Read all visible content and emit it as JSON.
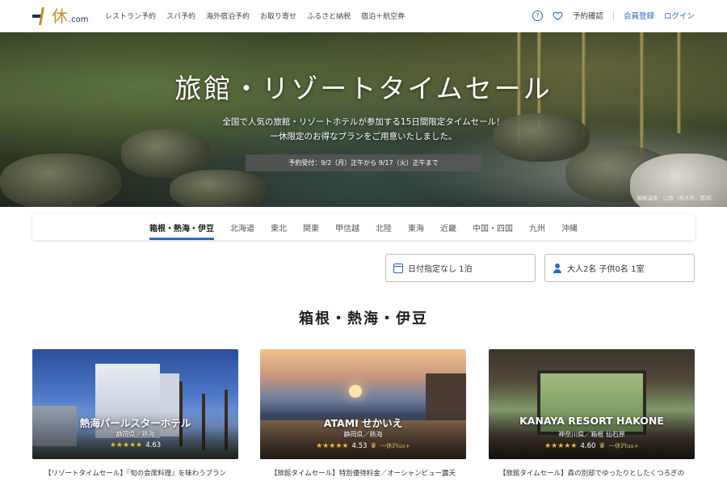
{
  "header": {
    "logo_kanji": "休",
    "logo_com": ".com",
    "nav": [
      "レストラン予約",
      "スパ予約",
      "海外宿泊予約",
      "お取り寄せ",
      "ふるさと納税",
      "宿泊＋航空券"
    ],
    "help_icon": "?",
    "confirm_label": "予約確認",
    "register_label": "会員登録",
    "login_label": "ログイン",
    "link_color": "#2a67c9"
  },
  "hero": {
    "title": "旅館・リゾートタイムセール",
    "subtitle_line1": "全国で人気の旅館・リゾートホテルが参加する15日間限定タイムセール！",
    "subtitle_line2": "一休限定のお得なプランをご用意いたしました。",
    "period": "予約受付：9/2（月）正午から 9/17（火）正午まで",
    "credit": "箱根温泉　山角（栃木県／那須）"
  },
  "tabs": [
    {
      "label": "箱根・熱海・伊豆",
      "active": true
    },
    {
      "label": "北海道",
      "active": false
    },
    {
      "label": "東北",
      "active": false
    },
    {
      "label": "関東",
      "active": false
    },
    {
      "label": "甲信越",
      "active": false
    },
    {
      "label": "北陸",
      "active": false
    },
    {
      "label": "東海",
      "active": false
    },
    {
      "label": "近畿",
      "active": false
    },
    {
      "label": "中国・四国",
      "active": false
    },
    {
      "label": "九州",
      "active": false
    },
    {
      "label": "沖縄",
      "active": false
    }
  ],
  "search": {
    "date_value": "日付指定なし 1泊",
    "guests_value": "大人2名  子供0名  1室"
  },
  "section_title": "箱根・熱海・伊豆",
  "cards": [
    {
      "name": "熱海パールスターホテル",
      "location": "静岡県／熱海",
      "stars": "★★★★★",
      "rating": "4.63",
      "plus": "",
      "desc": "【リゾートタイムセール】『旬の会席料理』を味わうプラン"
    },
    {
      "name": "ATAMI せかいえ",
      "location": "静岡県／熱海",
      "stars": "★★★★★",
      "rating": "4.53",
      "plus": "一休Plus+",
      "desc": "【旅館タイムセール】特別優待料金／オーシャンビュー露天"
    },
    {
      "name": "KANAYA RESORT HAKONE",
      "location": "神奈川県／箱根 仙石原",
      "stars": "★★★★★",
      "rating": "4.60",
      "plus": "一休Plus+",
      "desc": "【旅館タイムセール】森の別邸でゆったりとしたくつろぎの"
    }
  ]
}
